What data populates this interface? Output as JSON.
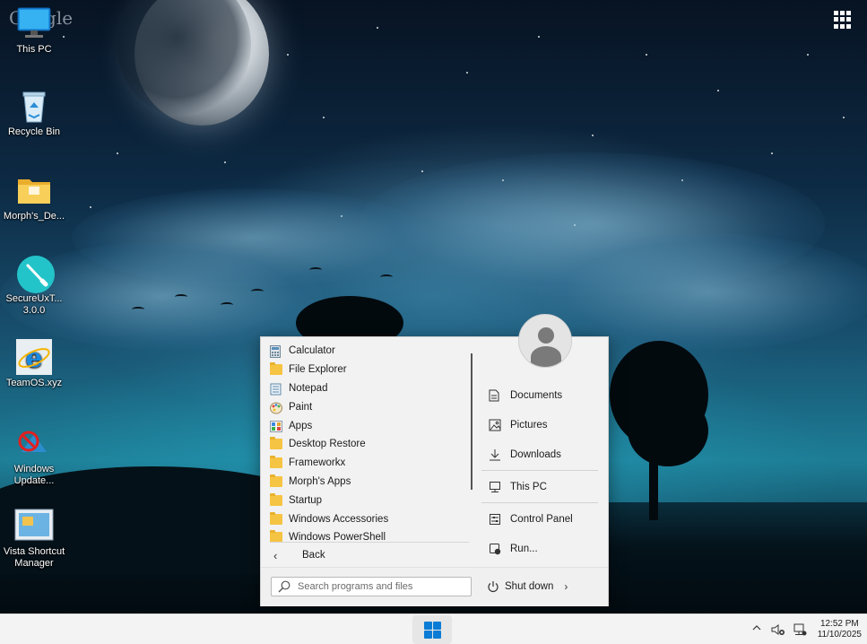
{
  "desktop": {
    "watermark": "Google",
    "icons": [
      {
        "label": "This PC",
        "icon": "monitor-icon"
      },
      {
        "label": "Recycle Bin",
        "icon": "recycle-bin-icon"
      },
      {
        "label": "Morph's_De...",
        "icon": "folder-icon"
      },
      {
        "label": "SecureUxT... 3.0.0",
        "icon": "brush-circle-icon"
      },
      {
        "label": "TeamOS.xyz",
        "icon": "internet-explorer-icon"
      },
      {
        "label": "Windows Update...",
        "icon": "windows-update-disabled-icon"
      },
      {
        "label": "Vista Shortcut Manager",
        "icon": "shortcut-manager-icon"
      }
    ]
  },
  "start_menu": {
    "programs": [
      {
        "label": "Calculator",
        "icon": "calculator-icon"
      },
      {
        "label": "File Explorer",
        "icon": "file-explorer-icon"
      },
      {
        "label": "Notepad",
        "icon": "notepad-icon"
      },
      {
        "label": "Paint",
        "icon": "paint-icon"
      },
      {
        "label": "Apps",
        "icon": "apps-icon"
      },
      {
        "label": "Desktop Restore",
        "icon": "folder-icon"
      },
      {
        "label": "Frameworkx",
        "icon": "folder-icon"
      },
      {
        "label": "Morph's Apps",
        "icon": "folder-icon"
      },
      {
        "label": "Startup",
        "icon": "folder-icon"
      },
      {
        "label": "Windows Accessories",
        "icon": "folder-icon"
      },
      {
        "label": "Windows PowerShell",
        "icon": "folder-icon"
      }
    ],
    "back_label": "Back",
    "places": [
      {
        "label": "Documents",
        "icon": "document-icon"
      },
      {
        "label": "Pictures",
        "icon": "picture-icon"
      },
      {
        "label": "Downloads",
        "icon": "download-icon"
      },
      {
        "label": "This PC",
        "icon": "computer-icon"
      },
      {
        "label": "Control Panel",
        "icon": "control-panel-icon"
      },
      {
        "label": "Run...",
        "icon": "run-icon"
      }
    ],
    "search_placeholder": "Search programs and files",
    "shutdown_label": "Shut down"
  },
  "taskbar": {
    "clock_time": "12:52 PM",
    "clock_date": "11/10/2025",
    "accent": "#0b7cd5"
  }
}
